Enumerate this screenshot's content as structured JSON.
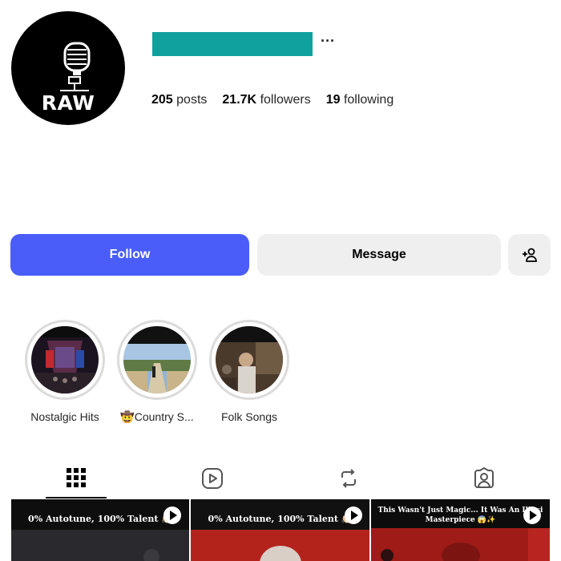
{
  "profile": {
    "avatar_text": "RAW",
    "more_label": "···",
    "stats": {
      "posts_count": "205",
      "posts_label": "posts",
      "followers_count": "21.7K",
      "followers_label": "followers",
      "following_count": "19",
      "following_label": "following"
    }
  },
  "actions": {
    "follow": "Follow",
    "message": "Message",
    "add_user_icon": "add-person-icon"
  },
  "highlights": [
    {
      "label": "Nostalgic Hits"
    },
    {
      "label": "🤠Country S..."
    },
    {
      "label": "Folk Songs"
    }
  ],
  "tabs": [
    {
      "icon": "grid-icon",
      "active": true
    },
    {
      "icon": "reels-icon"
    },
    {
      "icon": "reposts-icon"
    },
    {
      "icon": "tagged-icon"
    }
  ],
  "posts": [
    {
      "caption": "0% Autotune, 100% Talent 👏🏻"
    },
    {
      "caption": "0% Autotune, 100% Talent 👏🏻"
    },
    {
      "caption_line1": "This Wasn't Just Magic... It Was An Illusi",
      "caption_line2": "Masterpiece 😱✨"
    }
  ],
  "colors": {
    "accent": "#4a5df9",
    "redacted": "#10a19d",
    "button_gray": "#efefef"
  }
}
